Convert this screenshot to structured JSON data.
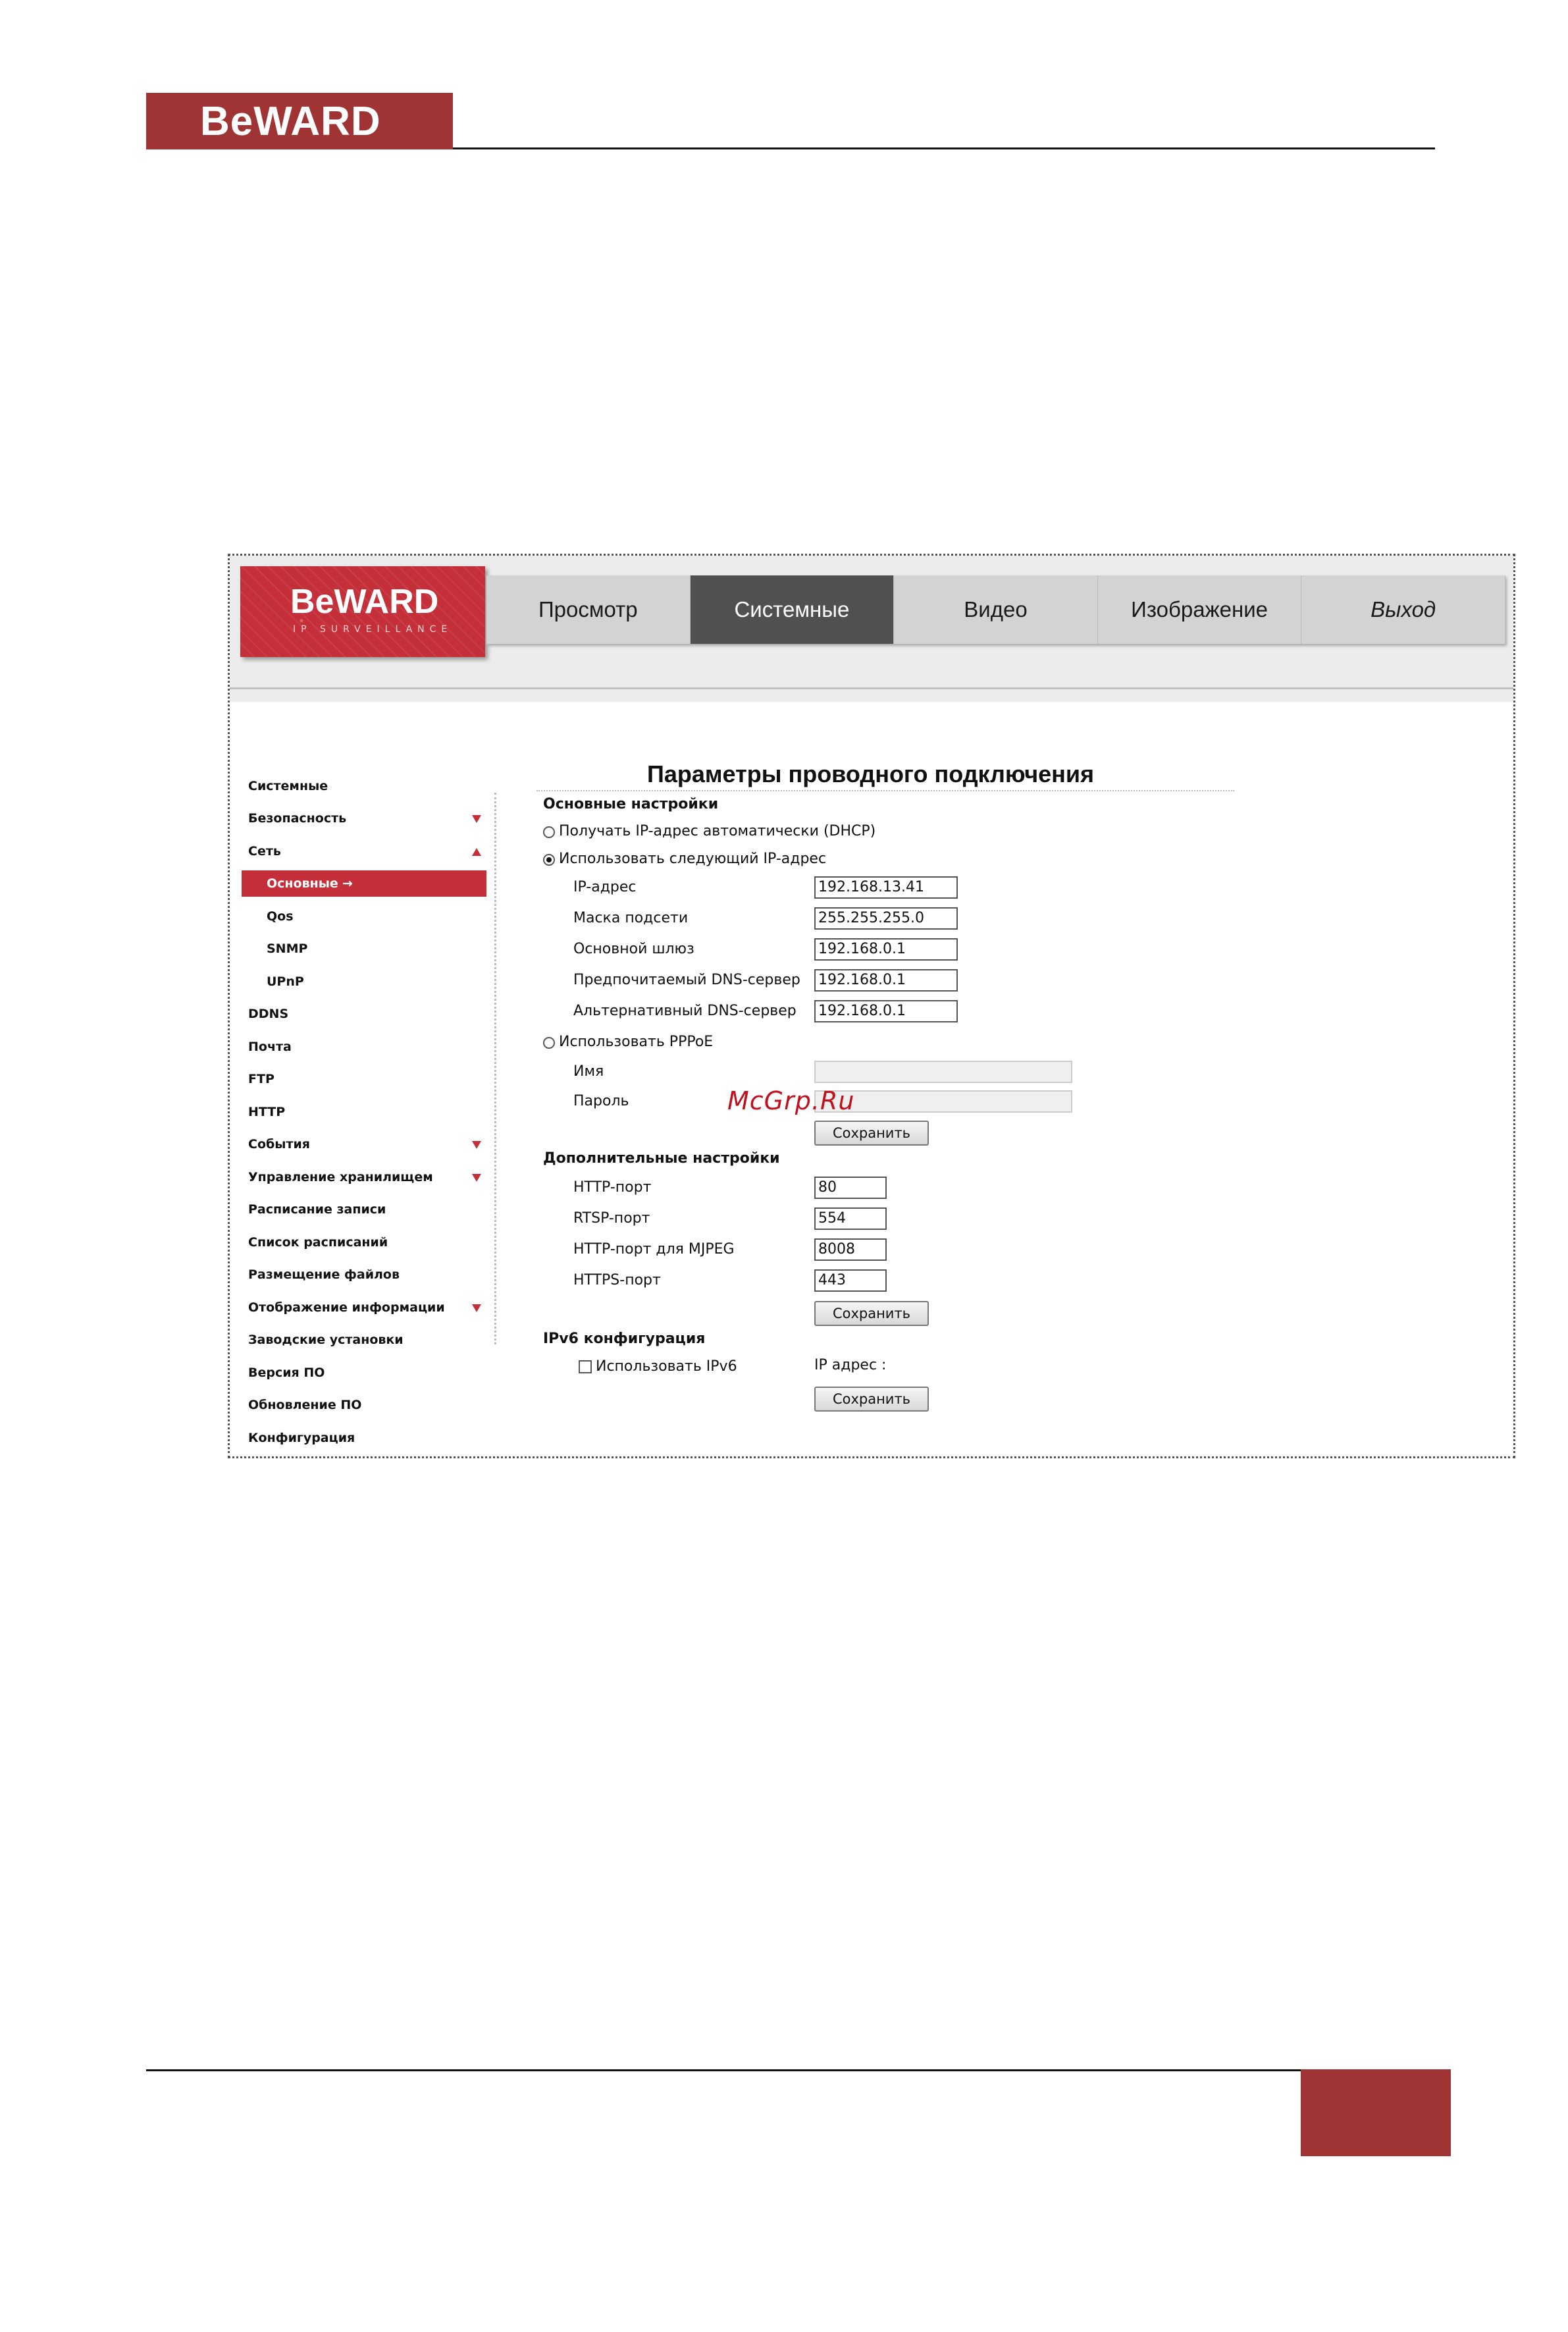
{
  "page": {
    "brand": "BeWARD"
  },
  "camera_ui": {
    "logo": {
      "brand": "BeWARD",
      "tagline": "IP SURVEILLANCE"
    },
    "tabs": [
      {
        "label": "Просмотр",
        "active": false
      },
      {
        "label": "Системные",
        "active": true
      },
      {
        "label": "Видео",
        "active": false
      },
      {
        "label": "Изображение",
        "active": false
      },
      {
        "label": "Выход",
        "active": false
      }
    ],
    "sidebar": [
      {
        "label": "Системные"
      },
      {
        "label": "Безопасность",
        "arrow": "down"
      },
      {
        "label": "Сеть",
        "arrow": "up"
      },
      {
        "label": "Основные",
        "active": true,
        "sub": true,
        "marker": "→"
      },
      {
        "label": "Qos",
        "sub": true
      },
      {
        "label": "SNMP",
        "sub": true
      },
      {
        "label": "UPnP",
        "sub": true
      },
      {
        "label": "DDNS"
      },
      {
        "label": "Почта"
      },
      {
        "label": "FTP"
      },
      {
        "label": "HTTP"
      },
      {
        "label": "События",
        "arrow": "down"
      },
      {
        "label": "Управление хранилищем",
        "arrow": "down"
      },
      {
        "label": "Расписание записи"
      },
      {
        "label": "Список расписаний"
      },
      {
        "label": "Размещение файлов"
      },
      {
        "label": "Отображение информации",
        "arrow": "down"
      },
      {
        "label": "Заводские установки"
      },
      {
        "label": "Версия ПО"
      },
      {
        "label": "Обновление ПО"
      },
      {
        "label": "Конфигурация"
      }
    ],
    "form": {
      "title": "Параметры проводного подключения",
      "basic": {
        "heading": "Основные настройки",
        "dhcp_label": "Получать IP-адрес автоматически (DHCP)",
        "static_label": "Использовать следующий IP-адрес",
        "fields": [
          {
            "label": "IP-адрес",
            "value": "192.168.13.41"
          },
          {
            "label": "Маска подсети",
            "value": "255.255.255.0"
          },
          {
            "label": "Основной шлюз",
            "value": "192.168.0.1"
          },
          {
            "label": "Предпочитаемый DNS-сервер",
            "value": "192.168.0.1"
          },
          {
            "label": "Альтернативный DNS-сервер",
            "value": "192.168.0.1"
          }
        ],
        "pppoe_label": "Использовать PPPoE",
        "pppoe_name_label": "Имя",
        "pppoe_password_label": "Пароль",
        "pppoe_name_value": "",
        "pppoe_password_value": "",
        "save_label": "Сохранить"
      },
      "advanced": {
        "heading": "Дополнительные настройки",
        "fields": [
          {
            "label": "HTTP-порт",
            "value": "80"
          },
          {
            "label": "RTSP-порт",
            "value": "554"
          },
          {
            "label": "HTTP-порт для MJPEG",
            "value": "8008"
          },
          {
            "label": "HTTPS-порт",
            "value": "443"
          }
        ],
        "save_label": "Сохранить"
      },
      "ipv6": {
        "heading": "IPv6 конфигурация",
        "checkbox_label": "Использовать IPv6",
        "ip_label": "IP адрес :",
        "save_label": "Сохранить"
      }
    },
    "site_mark": "McGrp.Ru"
  },
  "colors": {
    "brand_red": "#a03434",
    "ui_red": "#c42f3a",
    "active_tab": "#505050"
  }
}
